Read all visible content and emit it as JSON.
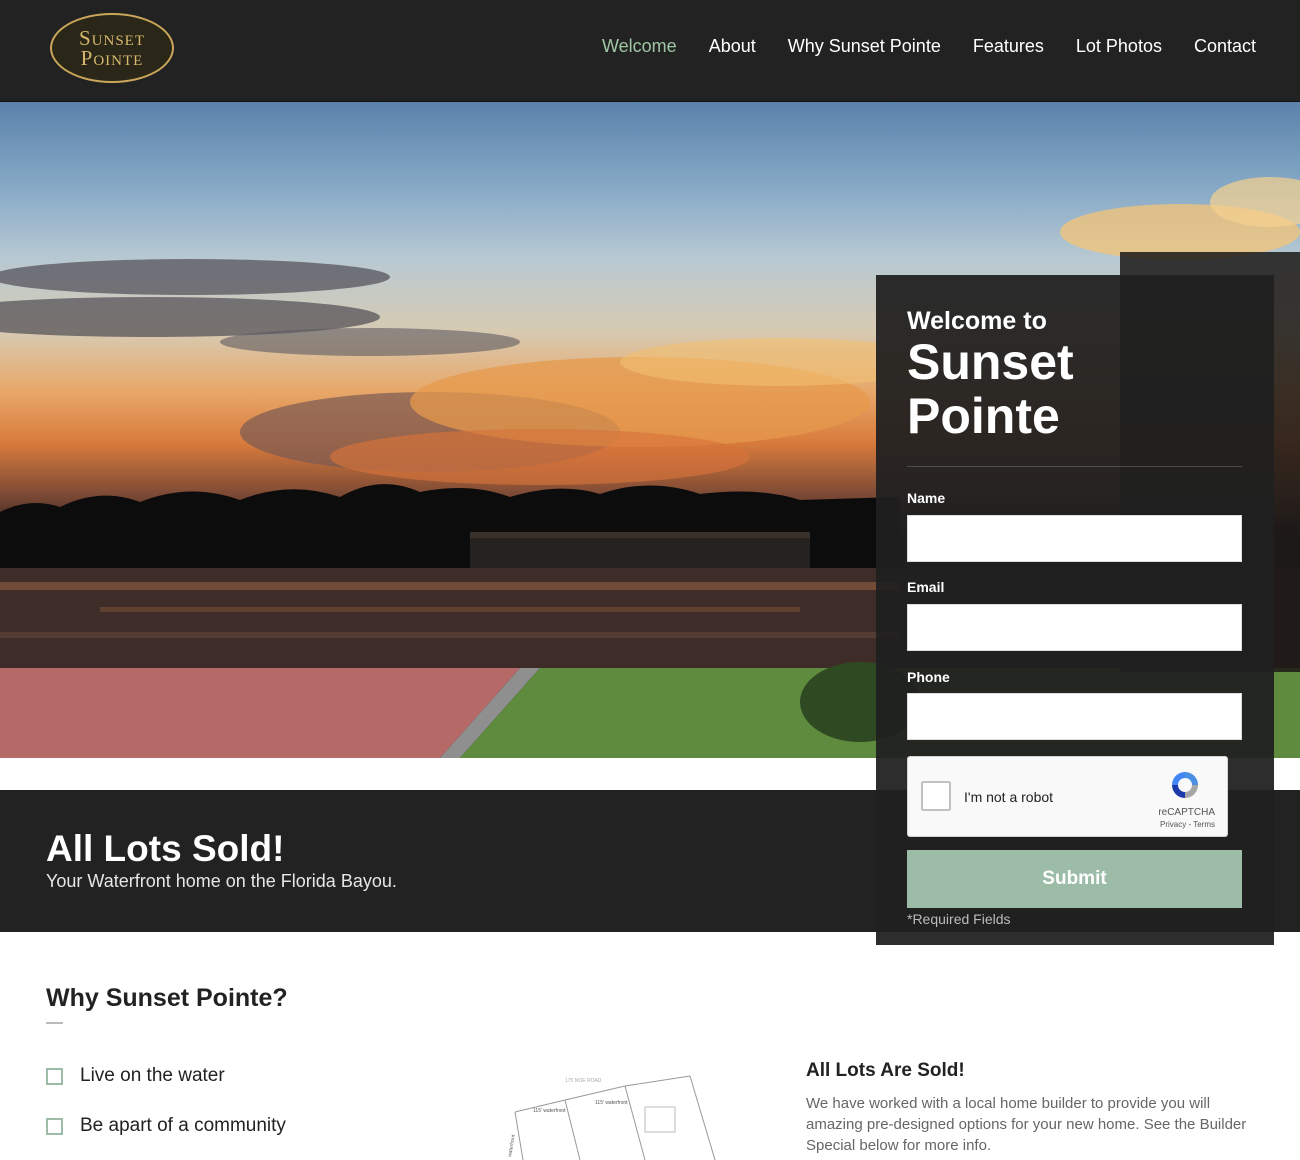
{
  "logo": {
    "line1": "Sunset",
    "line2": "Pointe"
  },
  "nav": {
    "items": [
      {
        "label": "Welcome",
        "active": true
      },
      {
        "label": "About",
        "active": false
      },
      {
        "label": "Why Sunset Pointe",
        "active": false
      },
      {
        "label": "Features",
        "active": false
      },
      {
        "label": "Lot Photos",
        "active": false
      },
      {
        "label": "Contact",
        "active": false
      }
    ],
    "active_color": "#9fc7a4"
  },
  "banner": {
    "title": "All Lots Sold!",
    "subtitle": "Your Waterfront home on the Florida Bayou."
  },
  "form": {
    "welcome": "Welcome to",
    "brand": "Sunset Pointe",
    "name_label": "Name",
    "email_label": "Email",
    "phone_label": "Phone",
    "name_value": "",
    "email_value": "",
    "phone_value": "",
    "recaptcha": {
      "label": "I'm not a robot",
      "brand": "reCAPTCHA",
      "links": "Privacy - Terms"
    },
    "submit_label": "Submit",
    "required_note": "*Required Fields",
    "submit_color": "#9cbca8"
  },
  "why": {
    "title": "Why Sunset Pointe?",
    "items": [
      "Live on the water",
      "Be apart of a community"
    ]
  },
  "lots": {
    "title": "All Lots Are Sold!",
    "text": "We have worked with a local home builder to provide you will amazing pre-designed options for your new home. See the Builder Special below for more info."
  },
  "map_labels": [
    "175 NOE ROAD",
    "115' waterfront",
    "115' waterfront",
    "waterfront"
  ]
}
